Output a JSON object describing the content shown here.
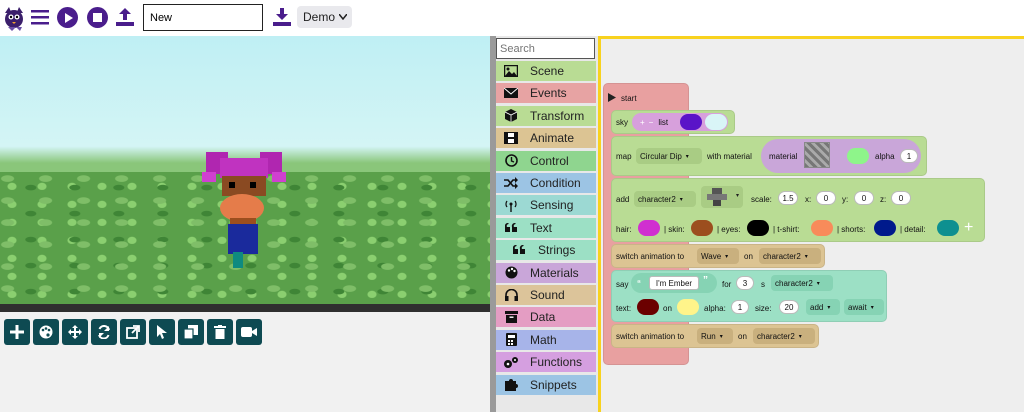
{
  "topbar": {
    "project_name": "New",
    "demo_select": "Demo"
  },
  "categories": {
    "search_placeholder": "Search",
    "items": [
      {
        "label": "Scene",
        "color": "#b9dc94",
        "icon": "image-icon"
      },
      {
        "label": "Events",
        "color": "#e7a3a3",
        "icon": "envelope-icon"
      },
      {
        "label": "Transform",
        "color": "#b9dc94",
        "icon": "cube-icon"
      },
      {
        "label": "Animate",
        "color": "#dcc493",
        "icon": "film-icon"
      },
      {
        "label": "Control",
        "color": "#8fd58f",
        "icon": "history-icon"
      },
      {
        "label": "Condition",
        "color": "#9cc4e4",
        "icon": "shuffle-icon"
      },
      {
        "label": "Sensing",
        "color": "#9cd9d3",
        "icon": "antenna-icon"
      },
      {
        "label": "Text",
        "color": "#9ce0c5",
        "icon": "quote-icon"
      },
      {
        "label": "Strings",
        "color": "#9ce0c5",
        "icon": "quote-icon"
      },
      {
        "label": "Materials",
        "color": "#c9a6d9",
        "icon": "palette-icon"
      },
      {
        "label": "Sound",
        "color": "#dcc49a",
        "icon": "headphones-icon"
      },
      {
        "label": "Data",
        "color": "#e49dc3",
        "icon": "box-icon"
      },
      {
        "label": "Math",
        "color": "#a7b4e9",
        "icon": "calculator-icon"
      },
      {
        "label": "Functions",
        "color": "#d59fe0",
        "icon": "cogs-icon"
      },
      {
        "label": "Snippets",
        "color": "#9cc4e4",
        "icon": "puzzle-icon"
      }
    ]
  },
  "blocks": {
    "start": "start",
    "sky": {
      "label": "sky",
      "list": "list",
      "color1": "#5a14c8",
      "color2": "#d9f5f7"
    },
    "map": {
      "label": "map",
      "value": "Circular Dip",
      "with_material": "with material",
      "material": "material",
      "alpha_label": "alpha",
      "alpha": "1",
      "color": "#8ef58a"
    },
    "add": {
      "label": "add",
      "value": "character2",
      "scale_label": "scale:",
      "scale": "1.5",
      "x_label": "x:",
      "x": "0",
      "y_label": "y:",
      "y": "0",
      "z_label": "z:",
      "z": "0"
    },
    "colors": {
      "hair_label": "hair:",
      "hair": "#d02fd0",
      "skin_label": "| skin:",
      "skin": "#9c4e1e",
      "eyes_label": "| eyes:",
      "eyes": "#000000",
      "tshirt_label": "| t-shirt:",
      "tshirt": "#f88b5a",
      "shorts_label": "| shorts:",
      "shorts": "#001a8c",
      "detail_label": "| detail:",
      "detail": "#0e9090",
      "plus": "+"
    },
    "anim1": {
      "label": "switch animation to",
      "value": "Wave",
      "on": "on",
      "target": "character2"
    },
    "say": {
      "label": "say",
      "text": "I'm Ember",
      "for": "for",
      "seconds": "3",
      "s": "s",
      "target": "character2"
    },
    "text": {
      "label": "text:",
      "color": "#6b0000",
      "on": "on",
      "bg": "#fff48a",
      "alpha_label": "alpha:",
      "alpha": "1",
      "size_label": "size:",
      "size": "20",
      "mode": "add",
      "wait": "await"
    },
    "anim2": {
      "label": "switch animation to",
      "value": "Run",
      "on": "on",
      "target": "character2"
    }
  }
}
